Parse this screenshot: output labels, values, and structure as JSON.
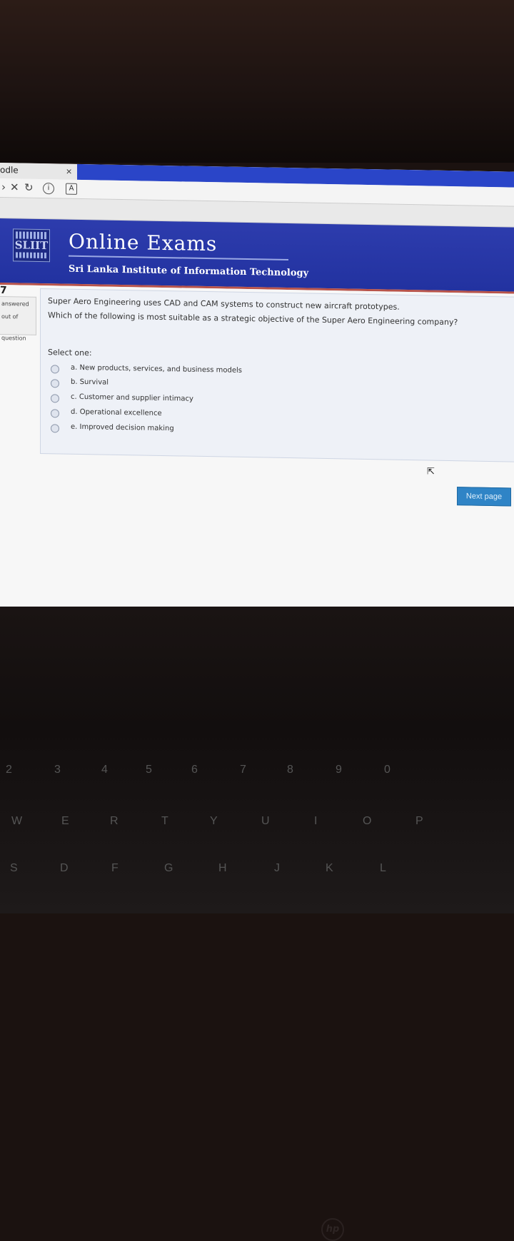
{
  "browser": {
    "tab_title": "odle",
    "tab_close": "×",
    "toolbar_icons": [
      "back-icon",
      "stop-icon",
      "reload-icon",
      "info-icon",
      "reader-icon"
    ]
  },
  "banner": {
    "title": "Online Exams",
    "subtitle": "Sri Lanka Institute of Information Technology",
    "logo_text": "SLIIT"
  },
  "nav": {
    "question_number": "7",
    "status_label": "answered",
    "mark_label": "out of",
    "flag_label": "question"
  },
  "question": {
    "line1": "Super Aero Engineering uses CAD and CAM systems to construct new aircraft prototypes.",
    "line2": "Which of the following is most suitable as a strategic objective of the Super Aero Engineering company?",
    "select_label": "Select one:",
    "options": [
      "a. New products, services, and business models",
      "b. Survival",
      "c. Customer and supplier intimacy",
      "d. Operational excellence",
      "e. Improved decision making"
    ]
  },
  "actions": {
    "next_label": "Next page"
  },
  "keyboard": {
    "row_numbers": [
      "2",
      "3",
      "4",
      "5",
      "6",
      "7",
      "8",
      "9",
      "0"
    ],
    "row_top": [
      "W",
      "E",
      "R",
      "T",
      "Y",
      "U",
      "I",
      "O",
      "P"
    ],
    "row_home": [
      "S",
      "D",
      "F",
      "G",
      "H",
      "J",
      "K",
      "L"
    ],
    "brand": "hp"
  },
  "colors": {
    "banner_blue": "#2232a0",
    "accent_red": "#b8534a",
    "button_blue": "#2f84c6"
  }
}
